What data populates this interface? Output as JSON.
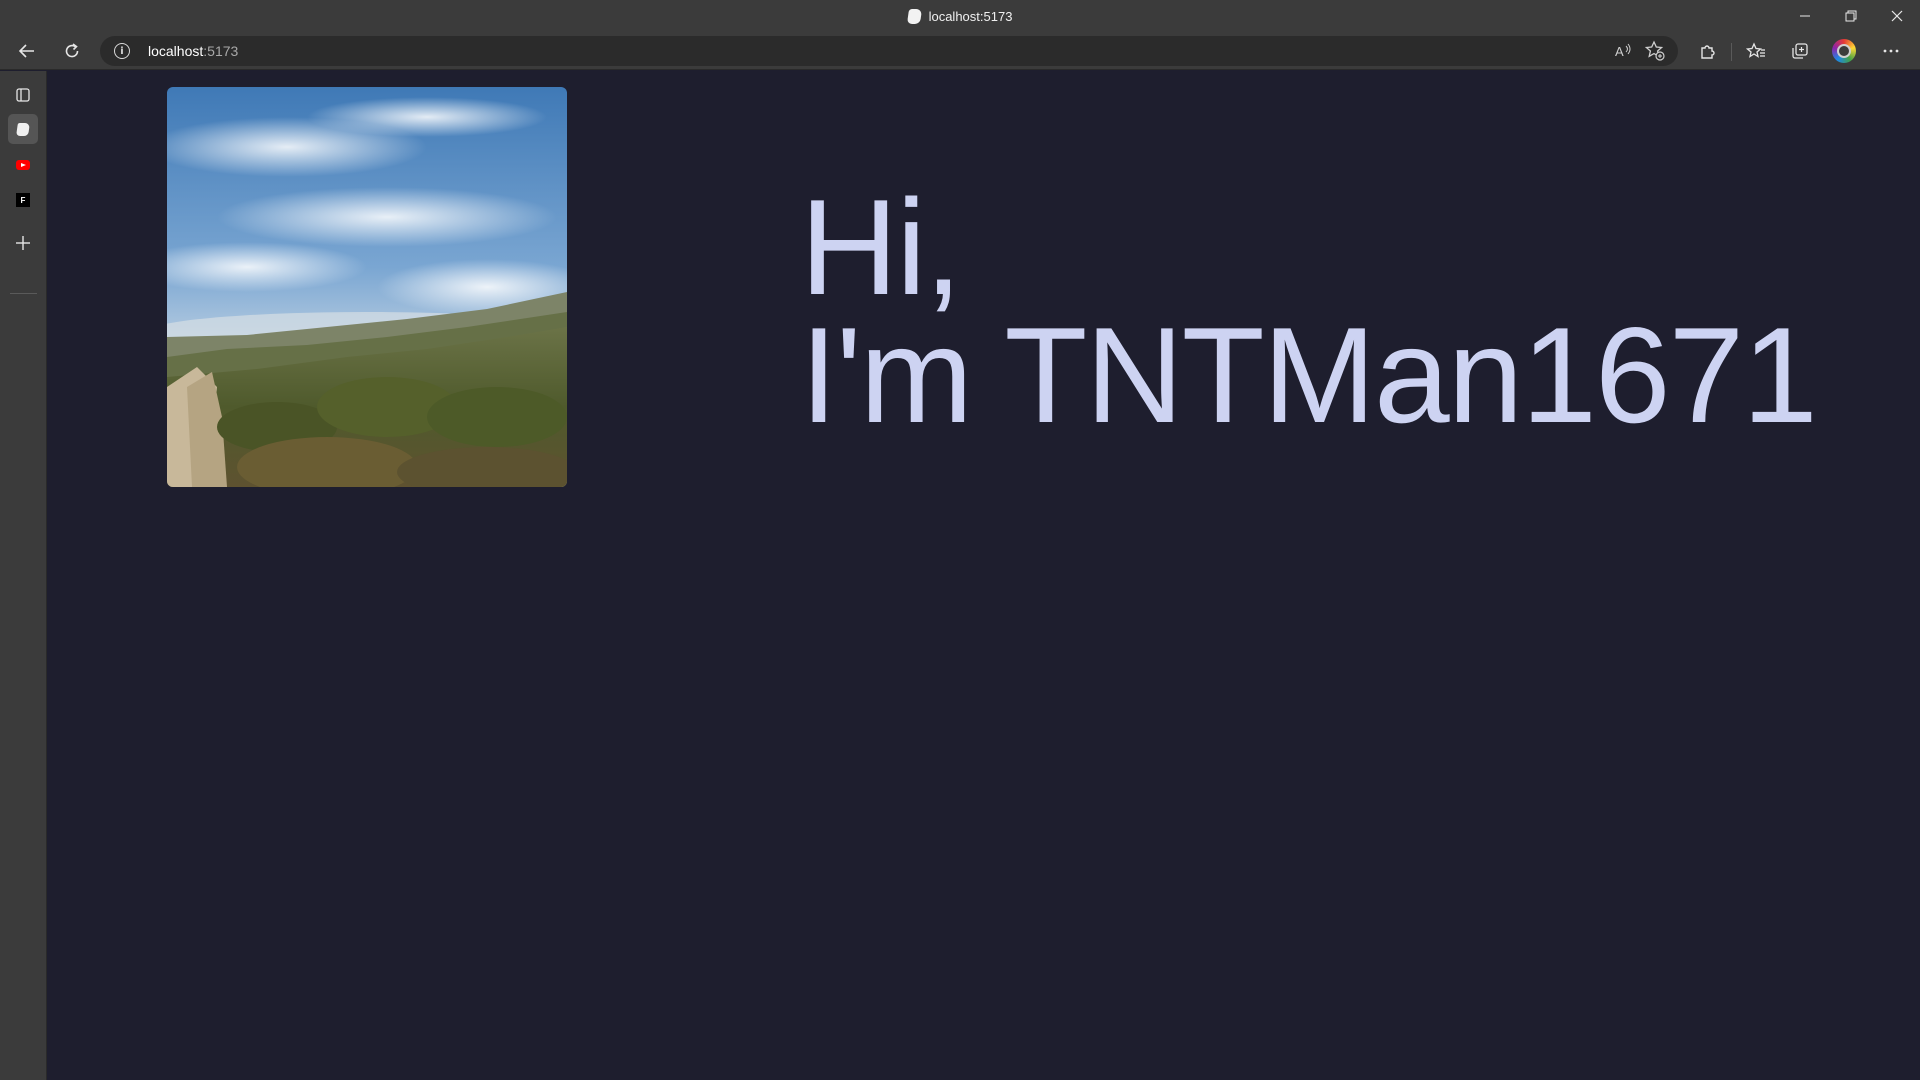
{
  "window": {
    "tab_title": "localhost:5173"
  },
  "address_bar": {
    "host": "localhost",
    "port": ":5173"
  },
  "sidebar": {
    "items": [
      {
        "name": "tab-actions",
        "icon": "tab-actions-icon"
      },
      {
        "name": "localhost-tab",
        "icon": "page-favicon",
        "active": true
      },
      {
        "name": "youtube-tab",
        "icon": "youtube-favicon"
      },
      {
        "name": "f-tab",
        "icon": "f-favicon",
        "glyph": "F"
      },
      {
        "name": "new-tab",
        "icon": "plus-icon"
      }
    ]
  },
  "page": {
    "greeting": "Hi,",
    "intro": "I'm TNTMan1671",
    "photo": "landscape photo of hillside trail under cloudy blue sky"
  },
  "colors": {
    "background": "#1e1e2e",
    "headline": "#cdd3f2",
    "chrome": "#3b3b3b"
  }
}
